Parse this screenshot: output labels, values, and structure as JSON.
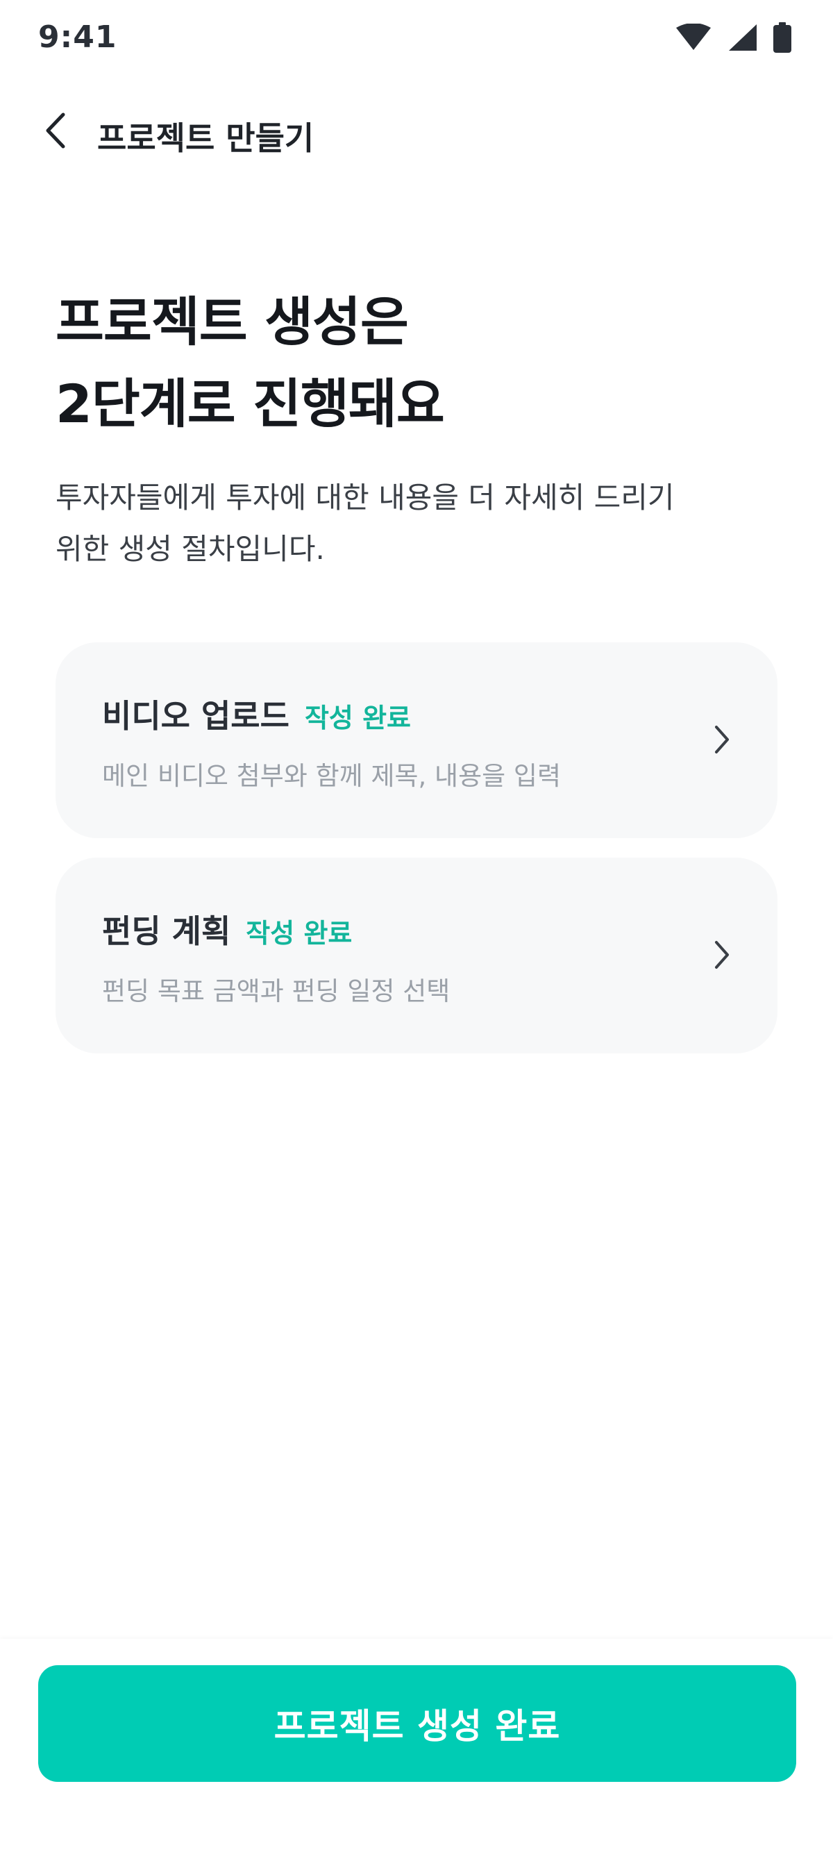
{
  "status_bar": {
    "time": "9:41",
    "icons": [
      "wifi-icon",
      "cellular-signal-icon",
      "battery-icon"
    ]
  },
  "header": {
    "back_icon": "chevron-left-icon",
    "title": "프로젝트 만들기"
  },
  "hero": {
    "title_lines": [
      "프로젝트 생성은",
      "2단계로 진행돼요"
    ],
    "description_lines": [
      "투자자들에게 투자에 대한 내용을 더 자세히 드리기",
      "위한 생성 절차입니다."
    ]
  },
  "steps": [
    {
      "title": "비디오 업로드",
      "badge": "작성 완료",
      "subtitle": "메인 비디오 첨부와 함께 제목, 내용을 입력",
      "icon": "chevron-right-icon"
    },
    {
      "title": "펀딩 계획",
      "badge": "작성 완료",
      "subtitle": "펀딩 목표 금액과 펀딩 일정 선택",
      "icon": "chevron-right-icon"
    }
  ],
  "footer": {
    "primary_button_label": "프로젝트 생성 완료"
  },
  "colors": {
    "accent": "#00ccb4",
    "badge": "#13b59b",
    "card_bg": "#f7f8f9",
    "text_primary": "#15181d",
    "text_secondary": "#9aa0a8"
  }
}
